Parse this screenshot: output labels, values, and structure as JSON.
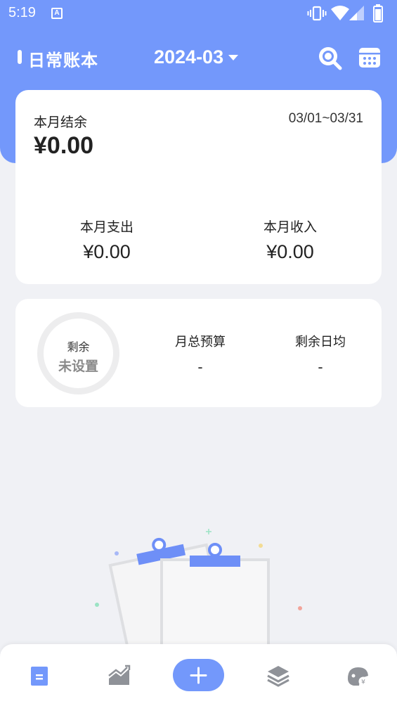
{
  "status_bar": {
    "time": "5:19",
    "notification_glyph": "A"
  },
  "app_bar": {
    "title": "日常账本",
    "month": "2024-03",
    "icons": [
      "search-icon",
      "calendar-icon"
    ]
  },
  "summary": {
    "balance_label": "本月结余",
    "balance_value": "¥0.00",
    "date_range": "03/01~03/31",
    "expense_label": "本月支出",
    "expense_value": "¥0.00",
    "income_label": "本月收入",
    "income_value": "¥0.00"
  },
  "budget": {
    "ring_label": "剩余",
    "ring_value": "未设置",
    "monthly_budget_label": "月总预算",
    "monthly_budget_value": "-",
    "daily_remaining_label": "剩余日均",
    "daily_remaining_value": "-"
  },
  "bottom_nav": {
    "items": [
      "ledger-icon",
      "chart-icon",
      "add-icon",
      "layers-icon",
      "piggy-bank-icon"
    ],
    "active_index": 0
  },
  "colors": {
    "accent": "#7398fb",
    "background": "#f0f1f5",
    "card": "#ffffff"
  }
}
